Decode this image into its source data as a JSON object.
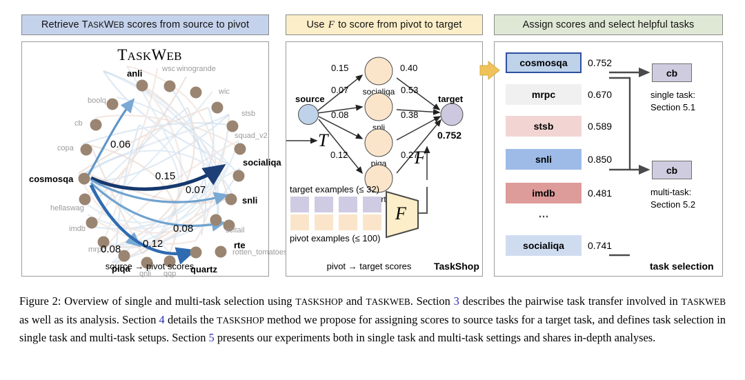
{
  "headers": {
    "left": {
      "pre": "Retrieve ",
      "sc": "TaskWeb",
      "post": " scores from source to pivot"
    },
    "middle": {
      "pre": "Use ",
      "math": "F",
      "post": " to score from pivot to target"
    },
    "right": {
      "text": "Assign scores and select helpful tasks"
    }
  },
  "left_panel": {
    "title": {
      "t1": "T",
      "t2": "ASK",
      "t3": "W",
      "t4": "EB"
    },
    "footer": "source → pivot scores",
    "nodes": [
      {
        "label": "anli",
        "prominent": true
      },
      {
        "label": "wsc",
        "prominent": false
      },
      {
        "label": "winogrande",
        "prominent": false
      },
      {
        "label": "wic",
        "prominent": false
      },
      {
        "label": "stsb",
        "prominent": false
      },
      {
        "label": "squad_v2",
        "prominent": false
      },
      {
        "label": "socialiqa",
        "prominent": true
      },
      {
        "label": "snli",
        "prominent": true
      },
      {
        "label": "scitail",
        "prominent": false
      },
      {
        "label": "rte",
        "prominent": true
      },
      {
        "label": "rotten_tomatoes",
        "prominent": false
      },
      {
        "label": "quartz",
        "prominent": true
      },
      {
        "label": "qqp",
        "prominent": false
      },
      {
        "label": "qnli",
        "prominent": false
      },
      {
        "label": "piqa",
        "prominent": true
      },
      {
        "label": "mrpc",
        "prominent": false
      },
      {
        "label": "imdb",
        "prominent": false
      },
      {
        "label": "hellaswag",
        "prominent": false
      },
      {
        "label": "cosmosqa",
        "prominent": true
      },
      {
        "label": "copa",
        "prominent": false
      },
      {
        "label": "cb",
        "prominent": false
      },
      {
        "label": "boolq",
        "prominent": false
      }
    ],
    "edge_labels": [
      "0.06",
      "0.15",
      "0.07",
      "0.08",
      "0.12",
      "0.08"
    ]
  },
  "middle_panel": {
    "source_label": "source",
    "target_label": "target",
    "target_value": "0.752",
    "T_symbol": "T",
    "F_symbol": "F",
    "F_box_symbol": "F",
    "pivots": [
      {
        "name": "socialiqa",
        "in_score": "0.15",
        "out_score": "0.40"
      },
      {
        "name": "snli",
        "in_score": "0.07",
        "out_score": "0.53"
      },
      {
        "name": "piqa",
        "in_score": "0.08",
        "out_score": "0.38"
      },
      {
        "name": "quartz",
        "in_score": "0.12",
        "out_score": "0.27"
      }
    ],
    "target_examples_label": "target examples (≤ 32)",
    "pivot_examples_label": "pivot examples (≤ 100)",
    "footer": "pivot → target scores",
    "brand": "TaskShop"
  },
  "right_panel": {
    "rows": [
      {
        "name": "cosmosqa",
        "score": "0.752",
        "color": "#bed2ea",
        "selected": true
      },
      {
        "name": "mrpc",
        "score": "0.670",
        "color": "#f0f0f0",
        "selected": false
      },
      {
        "name": "stsb",
        "score": "0.589",
        "color": "#f2d5d3",
        "selected": false
      },
      {
        "name": "snli",
        "score": "0.850",
        "color": "#9dbbe6",
        "selected": false
      },
      {
        "name": "imdb",
        "score": "0.481",
        "color": "#dd9b99",
        "selected": false
      },
      {
        "name": "socialiqa",
        "score": "0.741",
        "color": "#cfdcf0",
        "selected": false
      }
    ],
    "ellipsis": "⋯",
    "single_target": "cb",
    "multi_target": "cb",
    "single_caption_line1": "single task:",
    "single_caption_line2": "Section 5.1",
    "multi_caption_line1": "multi-task:",
    "multi_caption_line2": "Section 5.2",
    "footer": "task selection"
  },
  "caption": {
    "p1": "Figure 2: Overview of single and multi-task selection using ",
    "sc1": "TaskShop",
    "p2": " and ",
    "sc2": "TaskWeb",
    "p3": ". Section ",
    "n1": "3",
    "p4": " describes the pairwise task transfer involved in ",
    "sc3": "TaskWeb",
    "p5": " as well as its analysis. Section ",
    "n2": "4",
    "p6": " details the ",
    "sc4": "TaskShop",
    "p7": " method we propose for assigning scores to source tasks for a target task, and defines task selection in single task and multi-task setups. Section ",
    "n3": "5",
    "p8": " presents our experiments both in single task and multi-task settings and shares in-depth analyses."
  },
  "colors": {
    "header_blue": "#c5d2ec",
    "header_yellow": "#fbeec8",
    "header_green": "#dfe8d5",
    "node_brown": "#9a8572",
    "pivot_peach": "#fae5cb",
    "source_blue": "#bed2ea",
    "target_purple": "#cdc8e0",
    "arrow_yellow": "#efc35a",
    "highlight_border": "#2d4f9e"
  }
}
